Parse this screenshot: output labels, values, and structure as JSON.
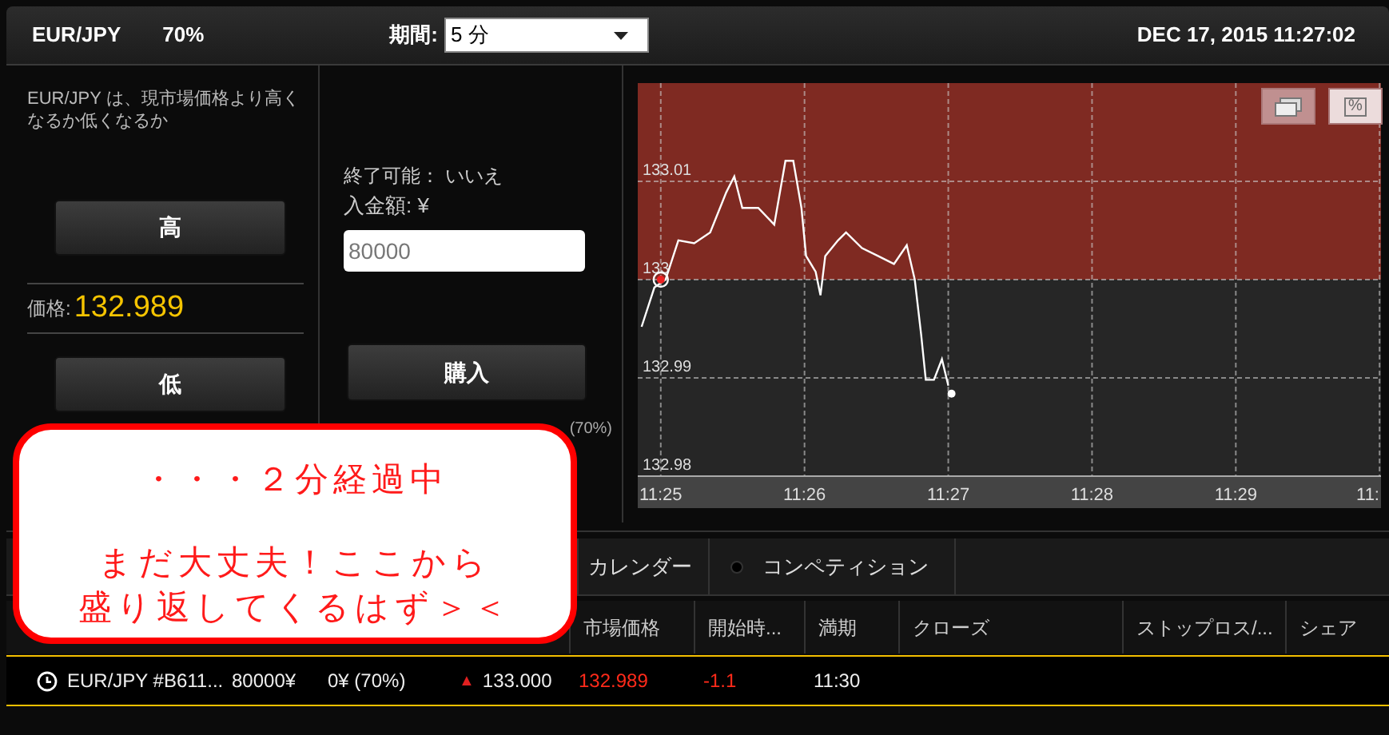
{
  "header": {
    "pair": "EUR/JPY",
    "payout": "70%",
    "period_label": "期間:",
    "period_value": "5 分",
    "datetime": "DEC 17, 2015 11:27:02"
  },
  "trade_panel": {
    "question": "EUR/JPY は、現市場価格より高くなるか低くなるか",
    "high_button": "高",
    "price_label": "価格:",
    "price": "132.989",
    "low_button": "低"
  },
  "order_panel": {
    "early_close": "終了可能： いいえ",
    "amount_label": "入金額: ¥",
    "amount_value": "80000",
    "buy_button": "購入",
    "payout_partial": "(70%)"
  },
  "chart": {
    "cut_axis_label": "11:",
    "buttons": [
      {
        "kind": "windows",
        "selected": false
      },
      {
        "kind": "percent",
        "label": "%",
        "selected": true
      }
    ],
    "chart_data": {
      "type": "line",
      "xlim": [
        684.84,
        690.01
      ],
      "ylim": [
        132.98,
        133.02
      ],
      "xticks": [
        {
          "value": 685,
          "label": "11:25"
        },
        {
          "value": 686,
          "label": "11:26"
        },
        {
          "value": 687,
          "label": "11:27"
        },
        {
          "value": 688,
          "label": "11:28"
        },
        {
          "value": 689,
          "label": "11:29"
        }
      ],
      "grid": true,
      "yticks": [
        {
          "value": 133.01,
          "label": "133.01"
        },
        {
          "value": 133.0,
          "label": "133"
        },
        {
          "value": 132.99,
          "label": "132.99"
        },
        {
          "value": 132.98,
          "label": "132.98"
        }
      ],
      "x": [
        684.867,
        684.956,
        685.033,
        685.122,
        685.233,
        685.344,
        685.456,
        685.511,
        685.567,
        685.678,
        685.789,
        685.867,
        685.922,
        685.978,
        686.011,
        686.078,
        686.111,
        686.144,
        686.233,
        686.289,
        686.4,
        686.511,
        686.622,
        686.711,
        686.767,
        686.811,
        686.844,
        686.9,
        686.956,
        687.0
      ],
      "series": [
        {
          "color": "#ffffff",
          "values": [
            132.9952,
            132.9992,
            133.0,
            133.004,
            133.0037,
            133.0048,
            133.0089,
            133.0105,
            133.0073,
            133.0073,
            133.0056,
            133.0121,
            133.0121,
            133.0073,
            133.0024,
            133.0008,
            132.9984,
            133.0024,
            133.004,
            133.0048,
            133.0032,
            133.0024,
            133.0016,
            133.0035,
            133.0,
            132.9944,
            132.9898,
            132.9898,
            132.9919,
            132.9892
          ]
        }
      ]
    }
  },
  "bottom_tabs": [
    {
      "label": "カレンダー",
      "kind": "plain"
    },
    {
      "label": "コンペティション",
      "kind": "dot"
    }
  ],
  "table": {
    "columns": [
      "",
      "",
      "",
      "",
      "市場価格",
      "開始時...",
      "満期",
      "クローズ",
      "ストップロス/...",
      "シェア"
    ],
    "rows": [
      {
        "cells": [
          {
            "text": "EUR/JPY #B611...",
            "color": "#eeeeee"
          },
          {
            "text": "80000¥",
            "color": "#eeeeee"
          },
          {
            "text": "0¥ (70%)",
            "color": "#eeeeee"
          },
          {
            "arrow": "▲",
            "text": "133.000",
            "color": "#eeeeee"
          },
          {
            "text": "132.989",
            "color": "#ff2a1a"
          },
          {
            "text": "-1.1",
            "color": "#ff2a1a"
          },
          {
            "text": "11:30",
            "color": "#eeeeee"
          }
        ]
      }
    ]
  },
  "callout": {
    "lines": [
      "・・・２分経過中",
      "まだ大丈夫！ここから",
      "盛り返してくるはず＞＜"
    ]
  }
}
